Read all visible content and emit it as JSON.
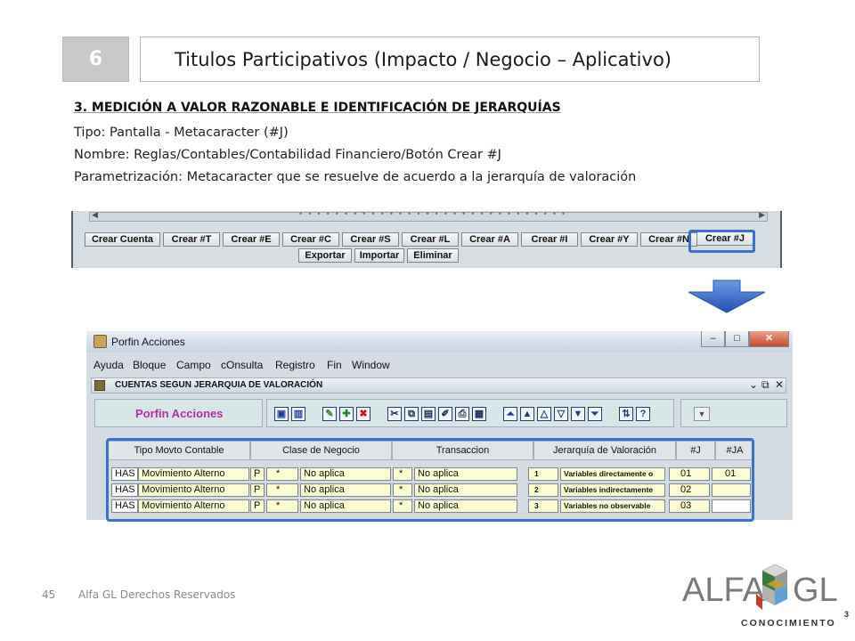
{
  "slide": {
    "number": "6",
    "title": "Titulos Participativos (Impacto / Negocio – Aplicativo)",
    "section_title": "3. MEDICIÓN A VALOR RAZONABLE E IDENTIFICACIÓN DE JERARQUÍAS",
    "lines": [
      "Tipo: Pantalla - Metacaracter (#J)",
      "Nombre: Reglas/Contables/Contabilidad  Financiero/Botón Crear #J",
      "Parametrización: Metacaracter que se resuelve de acuerdo a la jerarquía de valoración"
    ]
  },
  "screen1": {
    "buttons_row1": [
      "Crear Cuenta",
      "Crear #T",
      "Crear #E",
      "Crear #C",
      "Crear #S",
      "Crear #L",
      "Crear #A",
      "Crear #I",
      "Crear #Y",
      "Crear #N",
      "Crear #J"
    ],
    "buttons_row2": [
      "Exportar",
      "Importar",
      "Eliminar"
    ],
    "scroll_dots": "• • • • • • • • • • • • • • • • • • • • • • • • • • • • • •"
  },
  "screen2": {
    "window_title": "Porfin Acciones",
    "window_controls": [
      "–",
      "□",
      "✕"
    ],
    "menu": [
      "Ayuda",
      "Bloque",
      "Campo",
      "cOnsulta",
      "Registro",
      "Fin",
      "Window"
    ],
    "inner_title": "CUENTAS SEGUN JERARQUIA DE VALORACIÓN",
    "inner_controls": [
      "⌄",
      "⧉",
      "✕"
    ],
    "app_label": "Porfin Acciones",
    "table": {
      "headers": [
        "Tipo Movto Contable",
        "Clase de Negocio",
        "Transaccion",
        "Jerarquía de Valoración",
        "#J",
        "#JA"
      ],
      "rows": [
        [
          "HAS",
          "Movimiento Alterno",
          "P",
          "*",
          "No aplica",
          "*",
          "No aplica",
          "1",
          "Variables directamente o",
          "01",
          "01"
        ],
        [
          "HAS",
          "Movimiento Alterno",
          "P",
          "*",
          "No aplica",
          "*",
          "No aplica",
          "2",
          "Variables indirectamente",
          "02",
          ""
        ],
        [
          "HAS",
          "Movimiento Alterno",
          "P",
          "*",
          "No aplica",
          "*",
          "No aplica",
          "3",
          "Variables  no observable",
          "03",
          ""
        ]
      ]
    }
  },
  "footer": {
    "page": "45",
    "text": "Alfa GL Derechos Reservados"
  },
  "logo": {
    "left": "ALFA",
    "right": "GL",
    "tagline": "CONOCIMIENTO",
    "superscript": "3"
  },
  "colors": {
    "highlight": "#3b6fd2",
    "porfin_text": "#b52ea0",
    "number_box": "#c8c8c8"
  }
}
